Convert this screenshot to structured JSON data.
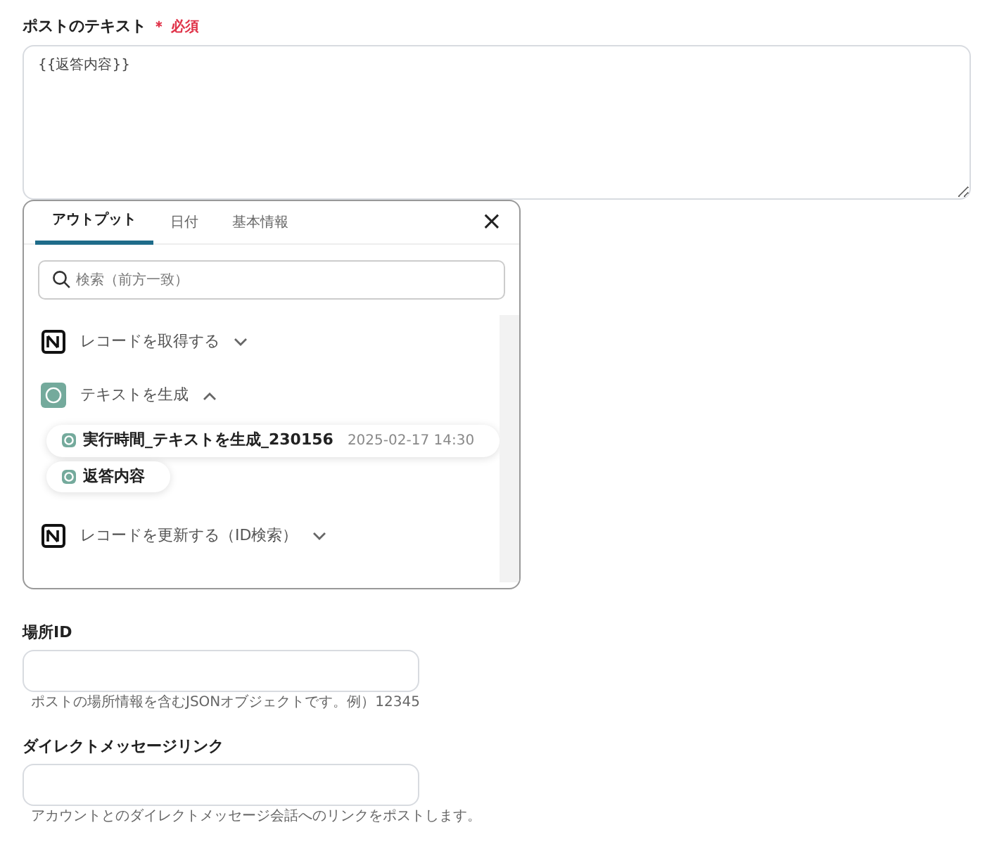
{
  "fields": [
    {
      "kind": "textarea",
      "label": "ポストのテキスト",
      "required_text": "＊ 必須",
      "value": "{{返答内容}}"
    },
    {
      "kind": "input",
      "label": "場所ID",
      "help": "ポストの場所情報を含むJSONオブジェクトです。例）12345"
    },
    {
      "kind": "input",
      "label": "ダイレクトメッセージリンク",
      "help": "アカウントとのダイレクトメッセージ会話へのリンクをポストします。"
    }
  ],
  "popup": {
    "tabs": [
      {
        "label": "アウトプット",
        "selected": true
      },
      {
        "label": "日付",
        "selected": false
      },
      {
        "label": "基本情報",
        "selected": false
      }
    ],
    "close": "×",
    "search": {
      "placeholder": "検索（前方一致）"
    },
    "groups": [
      {
        "kind": "notion",
        "title": "レコードを取得する",
        "expanded": false
      },
      {
        "kind": "ai",
        "title": "テキストを生成",
        "expanded": true,
        "items": [
          {
            "label": "実行時間_テキストを生成_230156",
            "time": "2025-02-17 14:30"
          },
          {
            "label": "返答内容"
          }
        ]
      },
      {
        "kind": "notion",
        "title": "レコードを更新する（ID検索）",
        "expanded": false
      }
    ]
  }
}
